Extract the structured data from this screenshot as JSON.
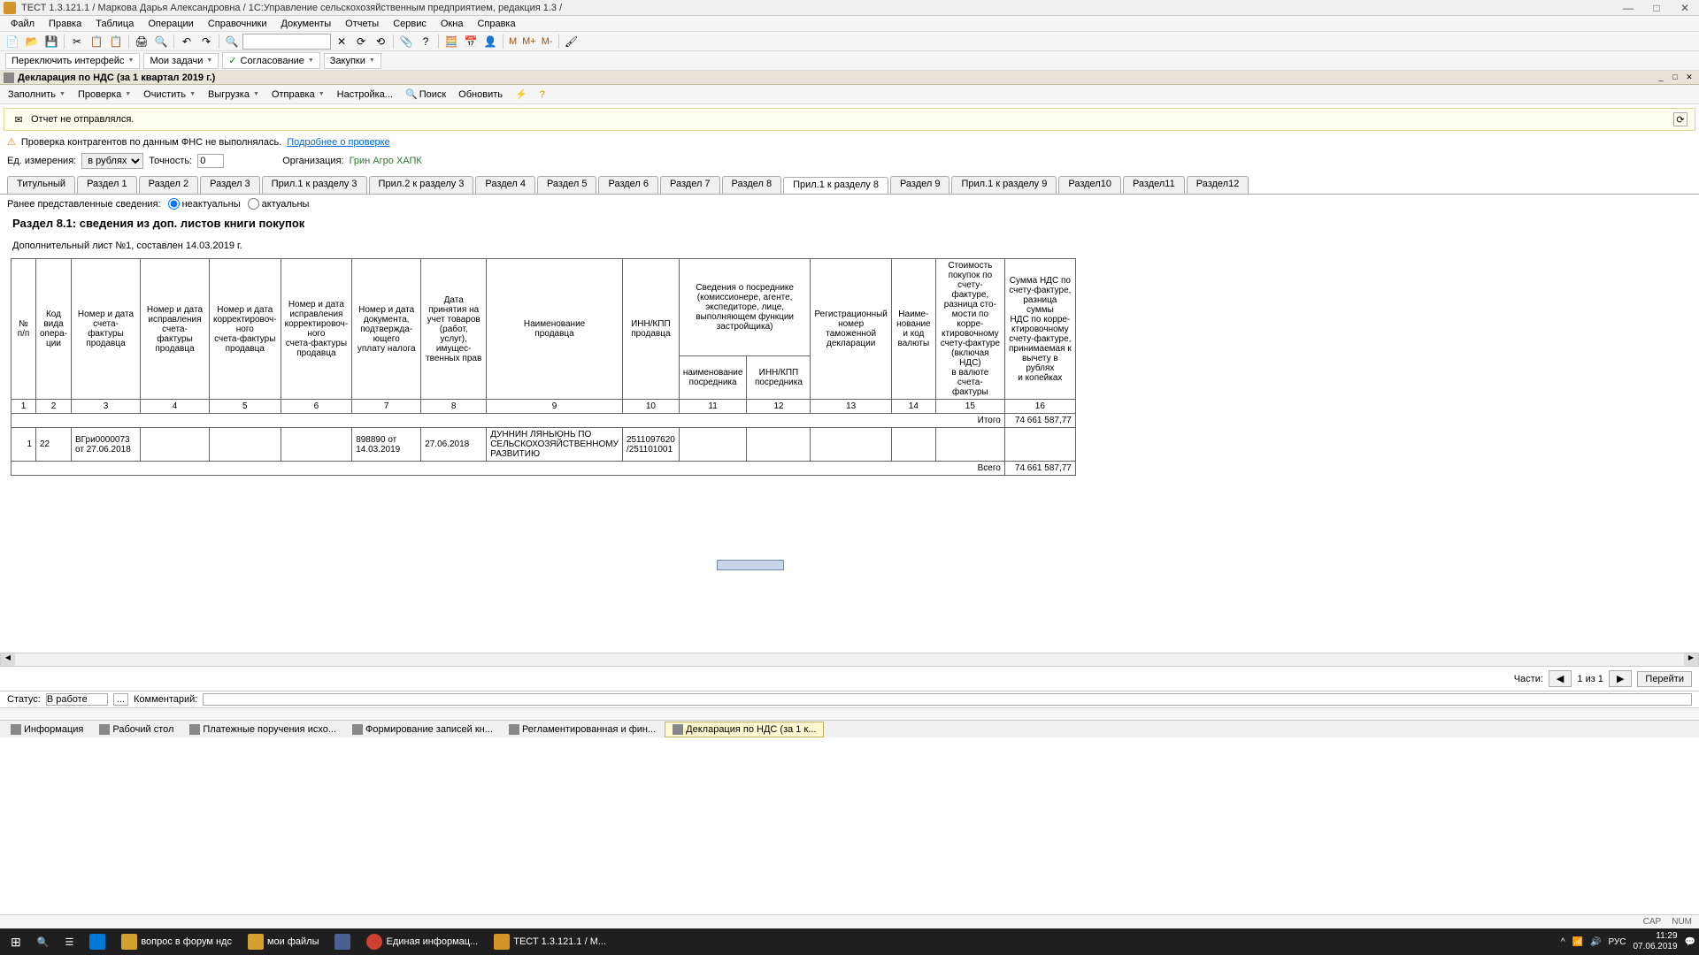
{
  "titlebar": {
    "text": "ТЕСТ 1.3.121.1 / Маркова Дарья Александровна / 1С:Управление сельскохозяйственным предприятием, редакция 1.3 /"
  },
  "menus": [
    "Файл",
    "Правка",
    "Таблица",
    "Операции",
    "Справочники",
    "Документы",
    "Отчеты",
    "Сервис",
    "Окна",
    "Справка"
  ],
  "toolbar_m": [
    "M",
    "M+",
    "M-"
  ],
  "secbar": {
    "switch": "Переключить интерфейс",
    "tasks": "Мои задачи",
    "approve": "Согласование",
    "purchase": "Закупки"
  },
  "doctitle": "Декларация по НДС (за 1 квартал 2019 г.)",
  "actionbar": {
    "fill": "Заполнить",
    "check": "Проверка",
    "clear": "Очистить",
    "upload": "Выгрузка",
    "send": "Отправка",
    "settings": "Настройка...",
    "search": "Поиск",
    "refresh": "Обновить"
  },
  "info1": {
    "text": "Отчет не отправлялся."
  },
  "info2": {
    "text": "Проверка контрагентов по данным ФНС не выполнялась.",
    "link": "Подробнее о проверке"
  },
  "params": {
    "unit_label": "Ед. измерения:",
    "unit_value": "в рублях",
    "precision_label": "Точность:",
    "precision_value": "0",
    "org_label": "Организация:",
    "org_value": "Грин Агро ХАПК"
  },
  "tabs": [
    "Титульный",
    "Раздел 1",
    "Раздел 2",
    "Раздел 3",
    "Прил.1 к разделу 3",
    "Прил.2 к разделу 3",
    "Раздел 4",
    "Раздел 5",
    "Раздел 6",
    "Раздел 7",
    "Раздел 8",
    "Прил.1 к разделу 8",
    "Раздел 9",
    "Прил.1 к разделу 9",
    "Раздел10",
    "Раздел11",
    "Раздел12"
  ],
  "active_tab": 11,
  "radio": {
    "label": "Ранее представленные сведения:",
    "opt1": "неактуальны",
    "opt2": "актуальны"
  },
  "section": {
    "title": "Раздел 8.1: сведения из доп. листов книги покупок",
    "sub": "Дополнительный лист №1, составлен 14.03.2019 г."
  },
  "headers": {
    "c1": "№\nп/п",
    "c2": "Код\nвида\nопера-\nции",
    "c3": "Номер и дата\nсчета-фактуры\nпродавца",
    "c4": "Номер и дата\nисправления\nсчета-фактуры\nпродавца",
    "c5": "Номер и дата\nкорректировоч-\nного\nсчета-фактуры\nпродавца",
    "c6": "Номер и дата\nисправления\nкорректировоч-\nного\nсчета-фактуры\nпродавца",
    "c7": "Номер и дата\nдокумента,\nподтвержда-\nющего\nуплату налога",
    "c8": "Дата\nпринятия на\nучет товаров\n(работ, услуг),\nимущес-\nтвенных прав",
    "c9": "Наименование\nпродавца",
    "c10": "ИНН/КПП\nпродавца",
    "c11top": "Сведения о посреднике\n(комиссионере, агенте,\nэкспедиторе, лице,\nвыполняющем функции\nзастройщика)",
    "c11": "наименование\nпосредника",
    "c12": "ИНН/КПП\nпосредника",
    "c13": "Регистрационный\nномер\nтаможенной\nдекларации",
    "c14": "Наиме-\nнование\nи код\nвалюты",
    "c15": "Стоимость\nпокупок по\nсчету-фактуре,\nразница сто-\nмости по корре-\nктировочному\nсчету-фактуре\n(включая НДС)\nв валюте\nсчета-фактуры",
    "c16": "Сумма НДС по\nсчету-фактуре,\nразница суммы\nНДС по корре-\nктировочному\nсчету-фактуре,\nпринимаемая к\nвычету в рублях\nи копейках"
  },
  "colnums": [
    "1",
    "2",
    "3",
    "4",
    "5",
    "6",
    "7",
    "8",
    "9",
    "10",
    "11",
    "12",
    "13",
    "14",
    "15",
    "16"
  ],
  "rows": [
    {
      "n": "1",
      "code": "22",
      "c3": "ВГри0000073 от 27.06.2018",
      "c7": "898890 от 14.03.2019",
      "c8": "27.06.2018",
      "c9": "ДУННИН ЛЯНЬЮНЬ ПО СЕЛЬСКОХОЗЯЙСТВЕННОМУ РАЗВИТИЮ",
      "c10": "2511097620 /251101001"
    }
  ],
  "totals": {
    "itogo_label": "Итого",
    "itogo_val": "74 661 587,77",
    "vsego_label": "Всего",
    "vsego_val": "74 661 587,77"
  },
  "footernav": {
    "parts": "Части:",
    "counter": "1 из 1",
    "go": "Перейти"
  },
  "status": {
    "label": "Статус:",
    "value": "В работе",
    "comment_label": "Комментарий:"
  },
  "btabs": [
    {
      "label": "Информация",
      "active": false
    },
    {
      "label": "Рабочий стол",
      "active": false
    },
    {
      "label": "Платежные поручения исхо...",
      "active": false
    },
    {
      "label": "Формирование записей кн...",
      "active": false
    },
    {
      "label": "Регламентированная и фин...",
      "active": false
    },
    {
      "label": "Декларация по НДС (за 1 к...",
      "active": true
    }
  ],
  "winstatus": {
    "cap": "CAP",
    "num": "NUM"
  },
  "taskbar": {
    "items": [
      {
        "label": "вопрос в форум ндс"
      },
      {
        "label": "мои файлы"
      },
      {
        "label": ""
      },
      {
        "label": "Единая информац..."
      },
      {
        "label": "ТЕСТ 1.3.121.1 / М..."
      }
    ],
    "lang": "РУС",
    "time": "11:29",
    "date": "07.06.2019"
  }
}
